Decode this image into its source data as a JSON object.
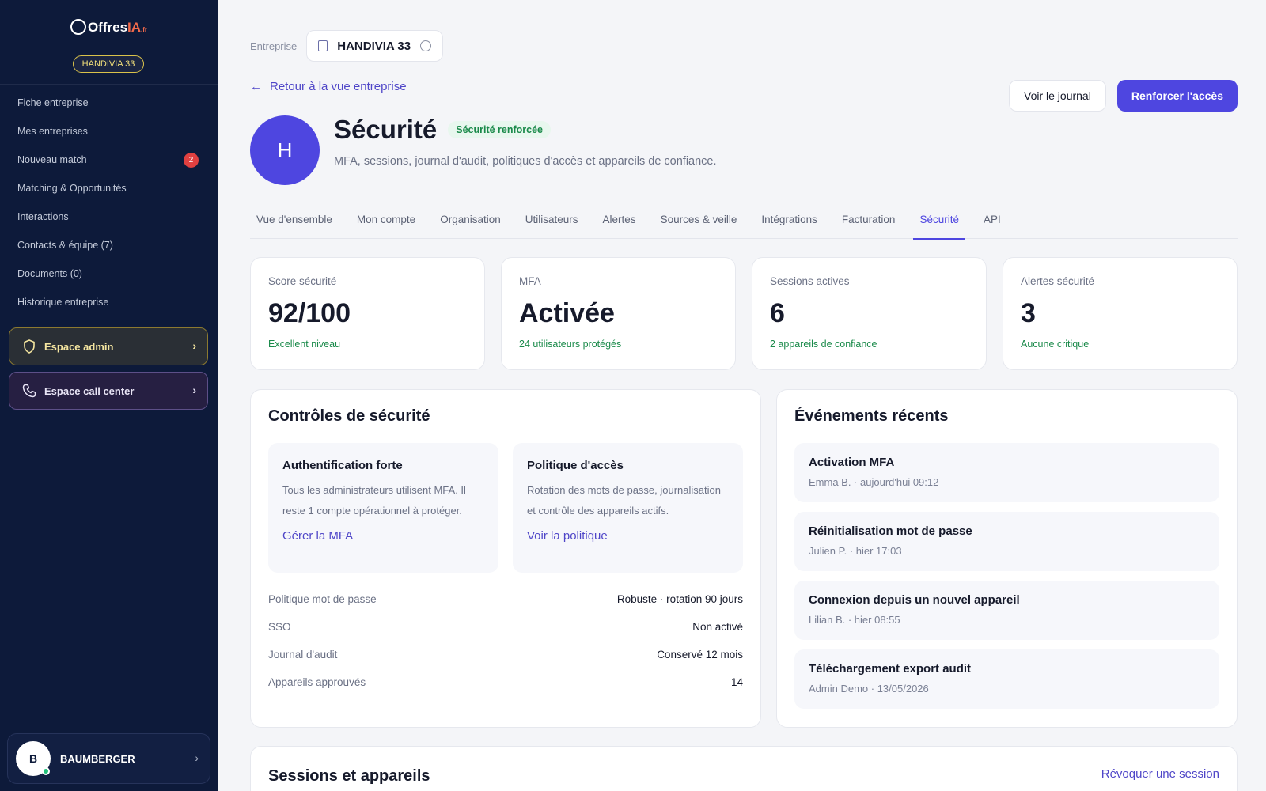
{
  "sidebar": {
    "logo": {
      "main": "Offres",
      "accent": "IA",
      "suffix": ".fr"
    },
    "org_badge": "HANDIVIA 33",
    "nav": [
      {
        "label": "Fiche entreprise"
      },
      {
        "label": "Mes entreprises"
      },
      {
        "label": "Nouveau match",
        "badge": "2"
      },
      {
        "label": "Matching & Opportunités"
      },
      {
        "label": "Interactions"
      },
      {
        "label": "Contacts & équipe (7)"
      },
      {
        "label": "Documents (0)"
      },
      {
        "label": "Historique entreprise"
      }
    ],
    "admin_space": "Espace admin",
    "call_center_space": "Espace call center",
    "user": {
      "initial": "B",
      "name": "BAUMBERGER"
    }
  },
  "header": {
    "entreprise_label": "Entreprise",
    "entreprise_name": "HANDIVIA 33",
    "back_link": "Retour à la vue entreprise",
    "journal_button": "Voir le journal",
    "primary_button": "Renforcer l'accès",
    "avatar_initial": "H",
    "title": "Sécurité",
    "status_badge": "Sécurité renforcée",
    "subtitle": "MFA, sessions, journal d'audit, politiques d'accès et appareils de confiance."
  },
  "tabs": [
    {
      "label": "Vue d'ensemble"
    },
    {
      "label": "Mon compte"
    },
    {
      "label": "Organisation"
    },
    {
      "label": "Utilisateurs"
    },
    {
      "label": "Alertes"
    },
    {
      "label": "Sources & veille"
    },
    {
      "label": "Intégrations"
    },
    {
      "label": "Facturation"
    },
    {
      "label": "Sécurité",
      "active": true
    },
    {
      "label": "API"
    }
  ],
  "kpis": [
    {
      "label": "Score sécurité",
      "value": "92/100",
      "sub": "Excellent niveau"
    },
    {
      "label": "MFA",
      "value": "Activée",
      "sub": "24 utilisateurs protégés"
    },
    {
      "label": "Sessions actives",
      "value": "6",
      "sub": "2 appareils de confiance"
    },
    {
      "label": "Alertes sécurité",
      "value": "3",
      "sub": "Aucune critique"
    }
  ],
  "controls": {
    "title": "Contrôles de sécurité",
    "cards": [
      {
        "title": "Authentification forte",
        "text": "Tous les administrateurs utilisent MFA. Il reste 1 compte opérationnel à protéger.",
        "link": "Gérer la MFA"
      },
      {
        "title": "Politique d'accès",
        "text": "Rotation des mots de passe, journalisation et contrôle des appareils actifs.",
        "link": "Voir la politique"
      }
    ],
    "settings": [
      {
        "key": "Politique mot de passe",
        "value": "Robuste · rotation 90 jours"
      },
      {
        "key": "SSO",
        "value": "Non activé"
      },
      {
        "key": "Journal d'audit",
        "value": "Conservé 12 mois"
      },
      {
        "key": "Appareils approuvés",
        "value": "14"
      }
    ]
  },
  "events": {
    "title": "Événements récents",
    "items": [
      {
        "title": "Activation MFA",
        "meta": "Emma B. · aujourd'hui 09:12"
      },
      {
        "title": "Réinitialisation mot de passe",
        "meta": "Julien P. · hier 17:03"
      },
      {
        "title": "Connexion depuis un nouvel appareil",
        "meta": "Lilian B. · hier 08:55"
      },
      {
        "title": "Téléchargement export audit",
        "meta": "Admin Demo · 13/05/2026"
      }
    ]
  },
  "sessions": {
    "title": "Sessions et appareils",
    "revoke_link": "Révoquer une session"
  },
  "colors": {
    "accent": "#4e46e0",
    "sidebar_bg": "#0d1a3a",
    "success": "#1a8a4a",
    "badge_red": "#e04040"
  },
  "icons": {
    "back": "arrow-left-icon",
    "building": "building-icon",
    "admin": "shield-icon",
    "call": "phone-icon",
    "chevron": "chevron-right-icon"
  }
}
